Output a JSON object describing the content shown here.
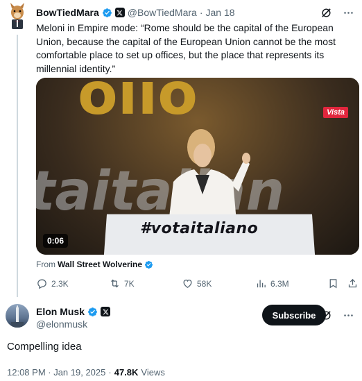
{
  "quoted_tweet": {
    "display_name": "BowTiedMara",
    "handle": "@BowTiedMara",
    "separator": "·",
    "date": "Jan 18",
    "text": "Meloni in Empire mode: “Rome should be the capital of the European Union, because the capital of the European Union cannot be the most comfortable place to set up offices, but the place that represents its millennial identity.”",
    "media": {
      "duration": "0:06",
      "podium_text": "#votaitaliano",
      "watermark": "Vista"
    },
    "from_prefix": "From",
    "from_account": "Wall Street Wolverine",
    "metrics": {
      "replies": "2.3K",
      "reposts": "7K",
      "likes": "58K",
      "views": "6.3M"
    }
  },
  "reply": {
    "display_name": "Elon Musk",
    "handle": "@elonmusk",
    "subscribe_label": "Subscribe",
    "text": "Compelling idea",
    "timestamp": "12:08 PM · Jan 19, 2025",
    "separator": "·",
    "views_count": "47.8K",
    "views_label": "Views"
  },
  "colors": {
    "verified": "#1d9bf0",
    "text_primary": "#0f1419",
    "text_secondary": "#536471",
    "thread_line": "#cfd9de",
    "button_bg": "#0f1419"
  },
  "icons": [
    "verified-icon",
    "x-affiliate-icon",
    "grok-icon",
    "more-icon",
    "reply-icon",
    "repost-icon",
    "like-icon",
    "views-icon",
    "bookmark-icon",
    "share-icon"
  ]
}
